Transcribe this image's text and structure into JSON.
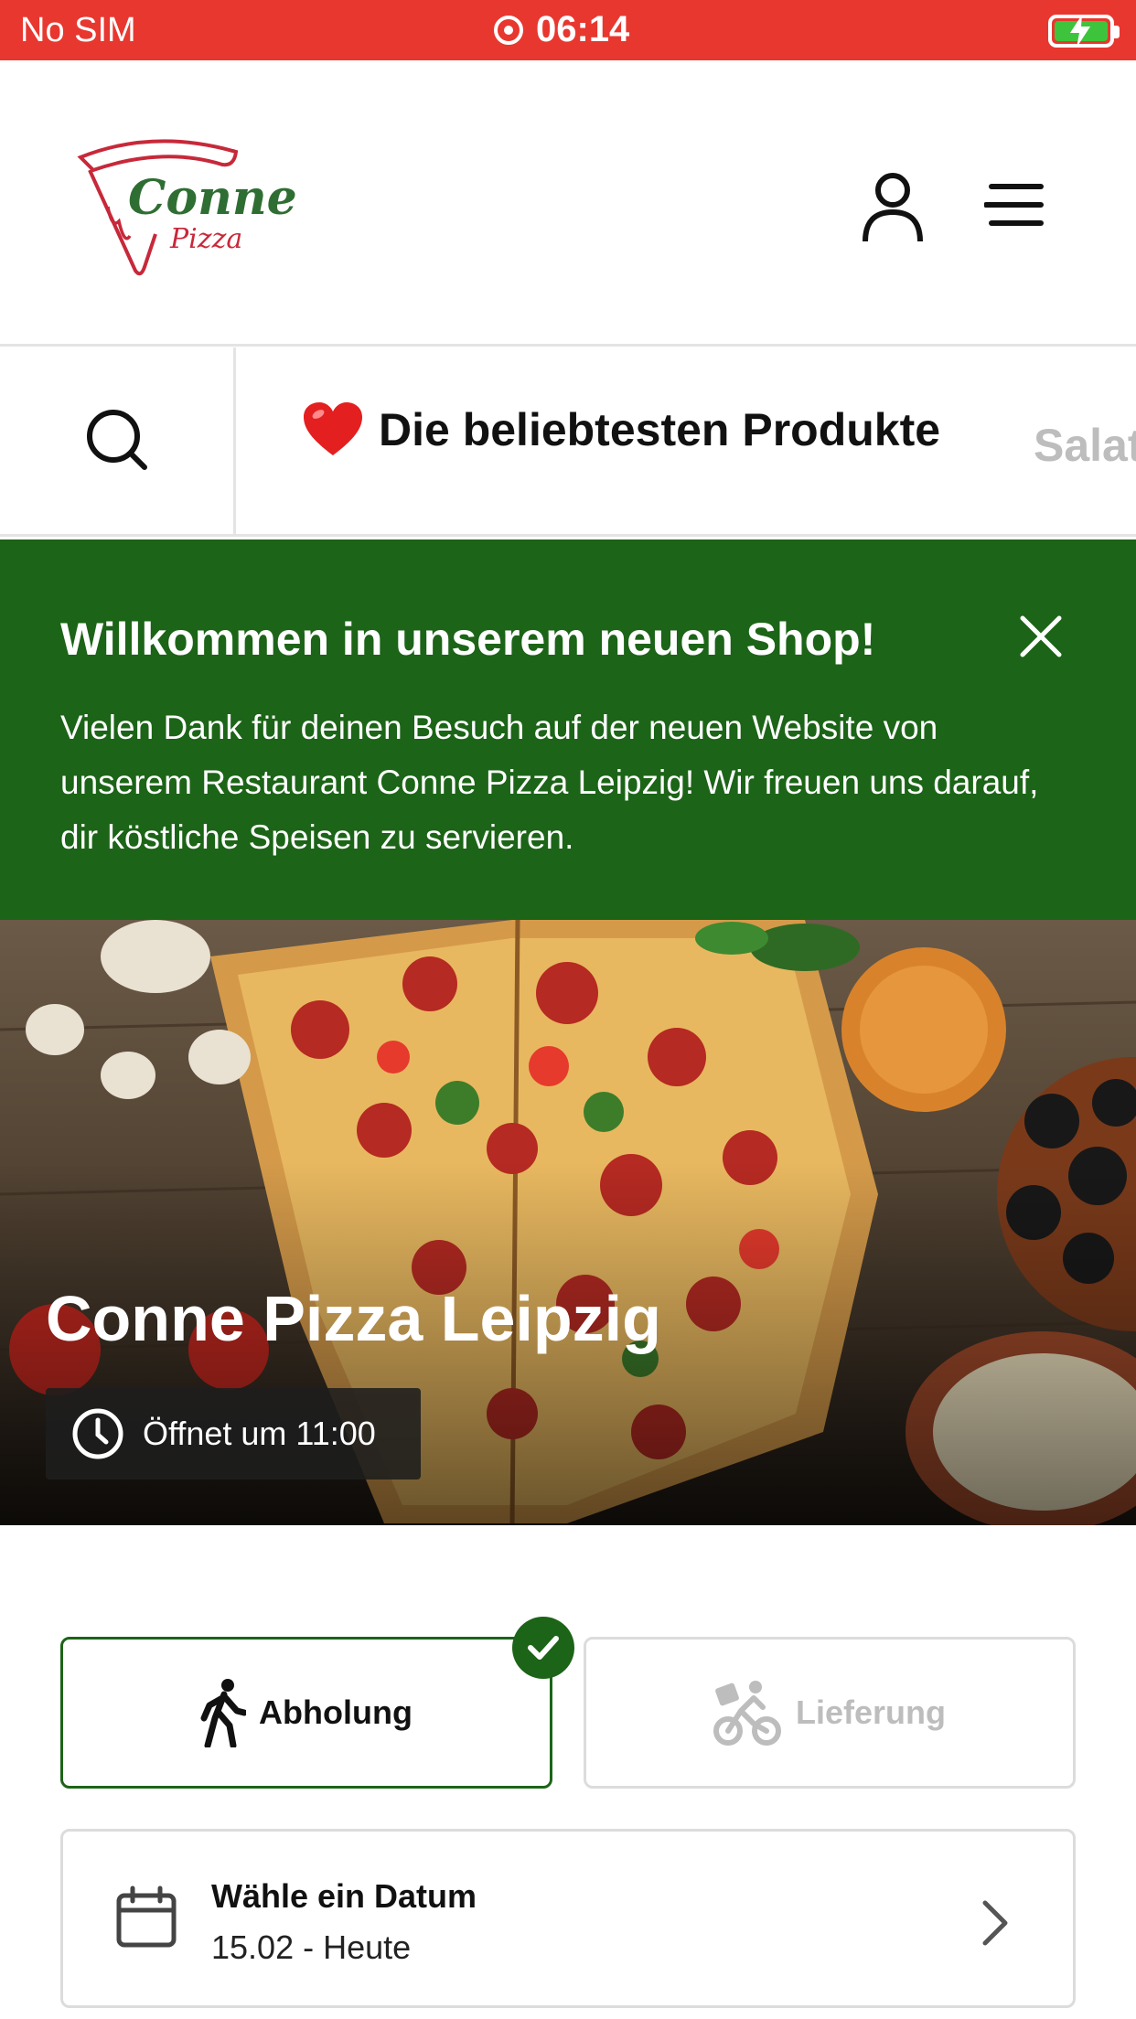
{
  "status_bar": {
    "carrier": "No SIM",
    "time": "06:14",
    "battery_color": "#3ec43c",
    "background": "#e8372f"
  },
  "header": {
    "logo": {
      "word1": "Conne",
      "word2": "Pizza",
      "colors": {
        "green": "#2f6e33",
        "red": "#c7293a"
      }
    },
    "icons": [
      "user-icon",
      "menu-icon"
    ]
  },
  "category_bar": {
    "active_category": "Die beliebtesten Produkte",
    "active_icon": "heart-icon",
    "next_category": "Salat"
  },
  "welcome_banner": {
    "title": "Willkommen in unserem neuen Shop!",
    "text": "Vielen Dank für deinen Besuch auf der neuen Website von unserem Restaurant Conne Pizza Leipzig! Wir freuen uns darauf, dir köstliche Speisen zu servieren.",
    "background": "#1c6417"
  },
  "hero": {
    "restaurant_name": "Conne Pizza Leipzig",
    "opening_status": "Öffnet um 11:00"
  },
  "order_type": {
    "pickup_label": "Abholung",
    "delivery_label": "Lieferung",
    "selected": "Abholung",
    "accent": "#1c6417"
  },
  "date_picker": {
    "title": "Wähle ein Datum",
    "value": "15.02 - Heute"
  }
}
